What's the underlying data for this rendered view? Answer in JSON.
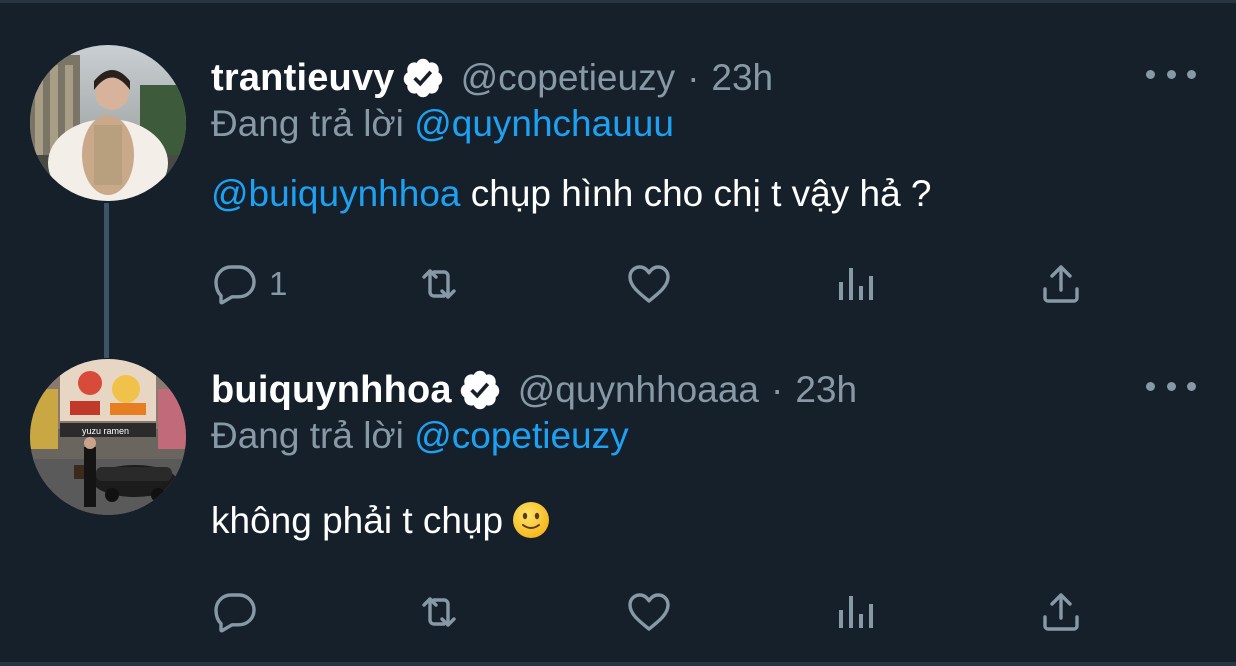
{
  "theme": {
    "background": "#15202b",
    "text_primary": "#ffffff",
    "text_secondary": "#8899a6",
    "accent": "#1da1f2",
    "thread_line": "#3d5466"
  },
  "tweets": [
    {
      "display_name": "trantieuvy",
      "verified": true,
      "handle": "@copetieuzy",
      "separator": "·",
      "time": "23h",
      "reply_prefix": "Đang trả lời",
      "reply_to": "@quynhchauuu",
      "body_mention": "@buiquynhhoa",
      "body_text": " chụp hình cho chị t vậy hả ?",
      "reply_count": "1",
      "icons": [
        "reply-icon",
        "retweet-icon",
        "like-icon",
        "stats-icon",
        "share-icon",
        "more-icon",
        "verified-icon"
      ]
    },
    {
      "display_name": "buiquynhhoa",
      "verified": true,
      "handle": "@quynhhoaaa",
      "separator": "·",
      "time": "23h",
      "reply_prefix": "Đang trả lời",
      "reply_to": "@copetieuzy",
      "body_text": "không phải t chụp",
      "body_emoji": "slightly-smiling-face-emoji",
      "icons": [
        "reply-icon",
        "retweet-icon",
        "like-icon",
        "stats-icon",
        "share-icon",
        "more-icon",
        "verified-icon"
      ]
    }
  ]
}
